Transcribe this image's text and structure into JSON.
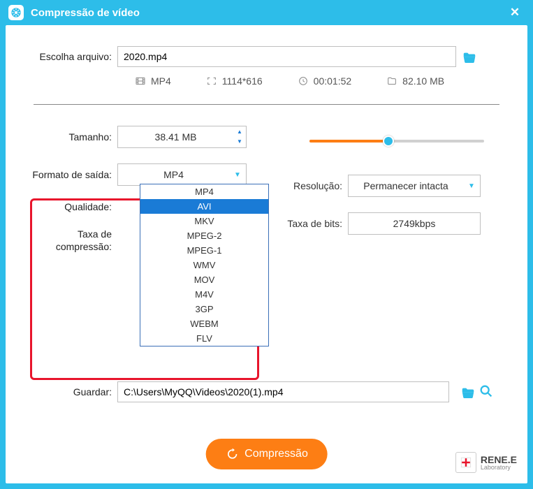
{
  "title": "Compressão de vídeo",
  "file": {
    "label": "Escolha arquivo:",
    "value": "2020.mp4"
  },
  "info": {
    "format": "MP4",
    "dimensions": "1114*616",
    "duration": "00:01:52",
    "size": "82.10 MB"
  },
  "size": {
    "label": "Tamanho:",
    "value": "38.41 MB"
  },
  "output_format": {
    "label": "Formato de saída:",
    "value": "MP4",
    "options": [
      "MP4",
      "AVI",
      "MKV",
      "MPEG-2",
      "MPEG-1",
      "WMV",
      "MOV",
      "M4V",
      "3GP",
      "WEBM",
      "FLV"
    ],
    "highlighted_index": 1
  },
  "quality": {
    "label": "Qualidade:"
  },
  "compression_rate": {
    "label": "Taxa de compressão:"
  },
  "resolution": {
    "label": "Resolução:",
    "value": "Permanecer intacta"
  },
  "bitrate": {
    "label": "Taxa de bits:",
    "value": "2749kbps"
  },
  "save": {
    "label": "Guardar:",
    "value": "C:\\Users\\MyQQ\\Videos\\2020(1).mp4"
  },
  "compress_button": "Compressão",
  "brand": {
    "name": "RENE.E",
    "sub": "Laboratory"
  }
}
